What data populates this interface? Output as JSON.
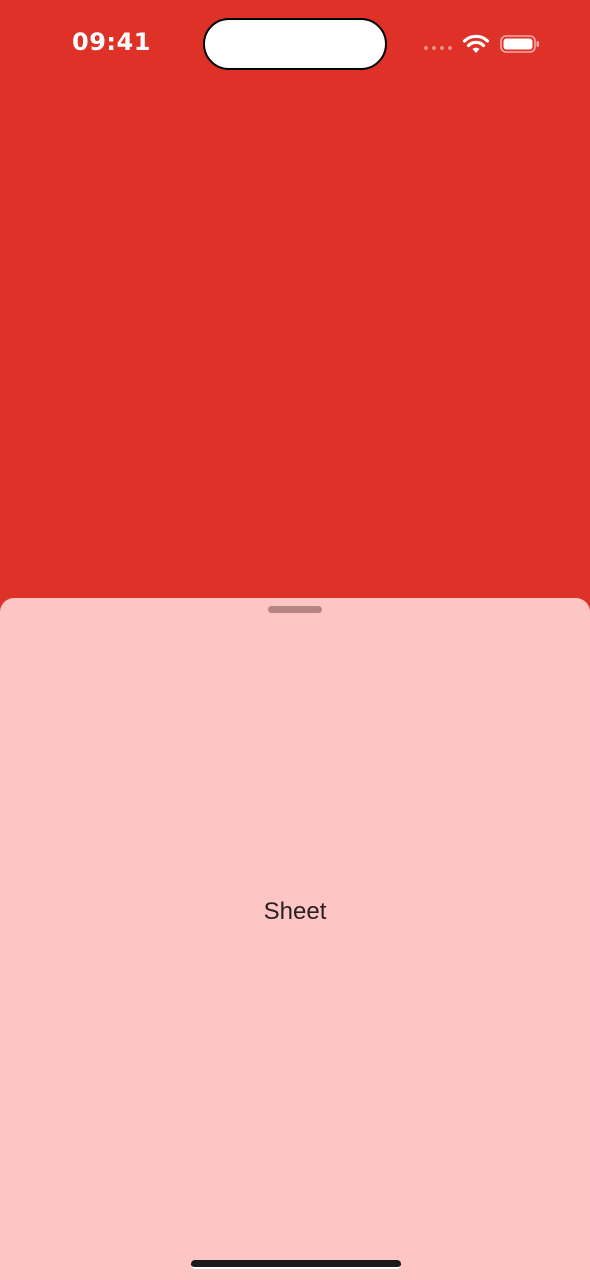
{
  "status_bar": {
    "time": "09:41",
    "signal_icon": "cellular-signal-icon",
    "wifi_icon": "wifi-icon",
    "battery_icon": "battery-icon"
  },
  "background": {
    "color": "#de3128"
  },
  "sheet": {
    "label": "Sheet",
    "color": "#fdc6c5",
    "grabber_icon": "sheet-grabber"
  },
  "colors": {
    "status_text": "#ffffff",
    "sheet_text": "#2a2020"
  }
}
